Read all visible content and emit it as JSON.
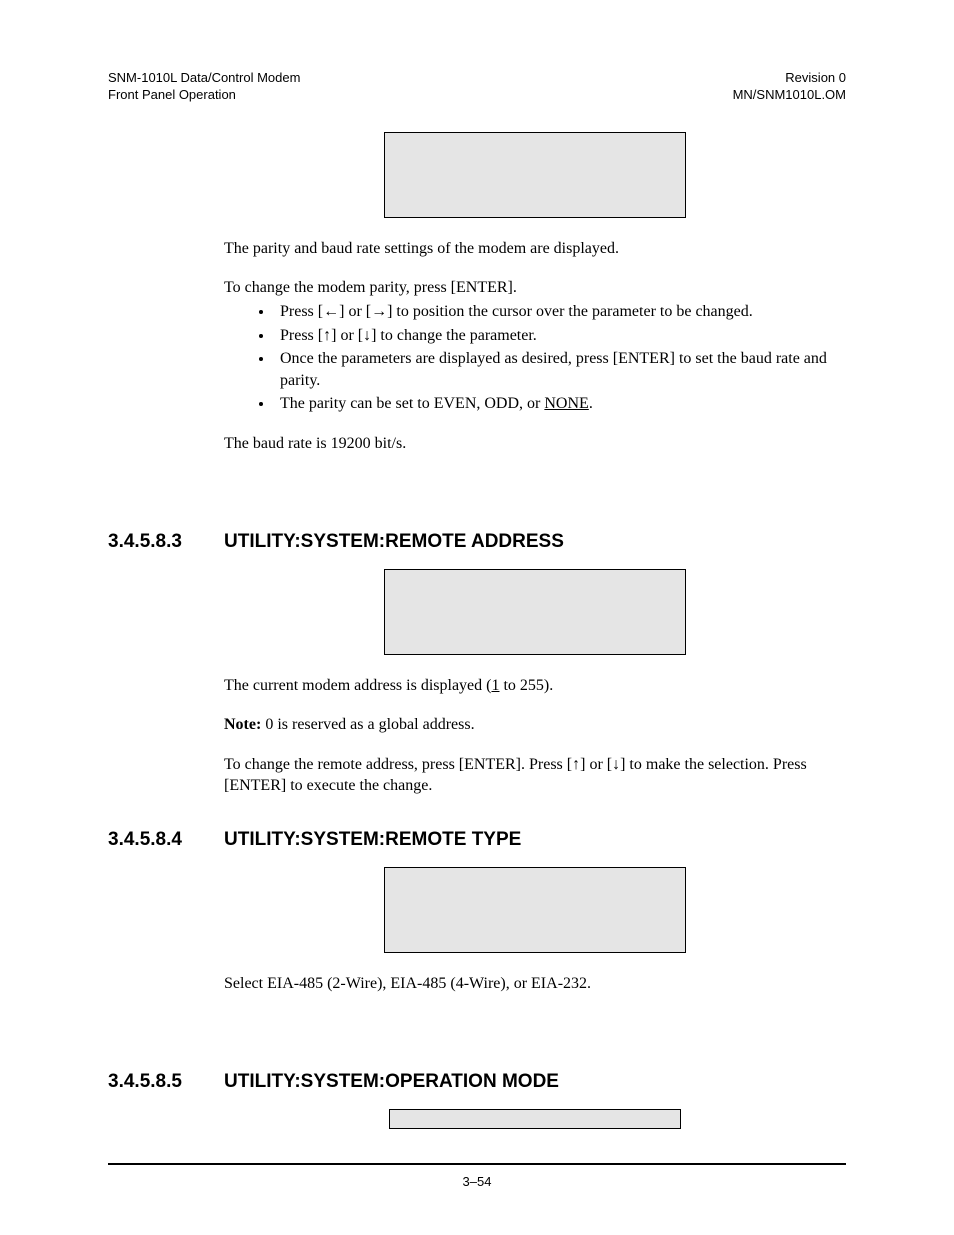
{
  "header": {
    "left1": "SNM-1010L Data/Control Modem",
    "left2": "Front Panel Operation",
    "right1": "Revision 0",
    "right2": "MN/SNM1010L.OM"
  },
  "intro": {
    "p1": "The parity and baud rate settings of the modem are displayed.",
    "p2": "To change the modem parity, press [ENTER].",
    "b1a": "Press [",
    "b1b": "] or [",
    "b1c": "] to position the cursor over the parameter to be changed.",
    "b2a": "Press [",
    "b2b": "] or [",
    "b2c": "] to change the parameter.",
    "b3": "Once the parameters are displayed as desired, press [ENTER] to set the baud rate and parity.",
    "b4a": "The parity can be set to EVEN, ODD, or ",
    "b4b": "NONE",
    "b4c": ".",
    "p3": "The baud rate is 19200 bit/s."
  },
  "arrows": {
    "left": "←",
    "right": "→",
    "up": "↑",
    "down": "↓"
  },
  "s3": {
    "num": "3.4.5.8.3",
    "title": "UTILITY:SYSTEM:REMOTE ADDRESS",
    "p1a": "The current modem address is displayed (",
    "p1b": "1",
    "p1c": " to 255).",
    "noteLabel": "Note:",
    "noteText": " 0 is reserved as a global address.",
    "p3a": "To change the remote address, press [ENTER]. Press [",
    "p3b": "] or [",
    "p3c": "] to make the selection. Press [ENTER] to execute the change."
  },
  "s4": {
    "num": "3.4.5.8.4",
    "title": "UTILITY:SYSTEM:REMOTE TYPE",
    "p1": "Select EIA-485 (2-Wire), EIA-485 (4-Wire), or EIA-232."
  },
  "s5": {
    "num": "3.4.5.8.5",
    "title": "UTILITY:SYSTEM:OPERATION MODE"
  },
  "footer": {
    "page": "3–54"
  }
}
